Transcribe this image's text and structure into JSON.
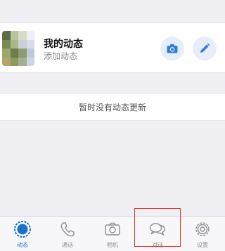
{
  "status": {
    "title": "我的动态",
    "subtitle": "添加动态",
    "camera_icon": "camera-icon",
    "pencil_icon": "pencil-icon"
  },
  "updates": {
    "empty_text": "暂时没有动态更新"
  },
  "tabbar": {
    "active": "动态",
    "tabs": [
      {
        "label": "动态",
        "icon": "status-ring-icon"
      },
      {
        "label": "通话",
        "icon": "phone-icon"
      },
      {
        "label": "相机",
        "icon": "camera-icon"
      },
      {
        "label": "对话",
        "icon": "chat-bubbles-icon"
      },
      {
        "label": "设置",
        "icon": "gear-icon"
      }
    ]
  },
  "colors": {
    "accent": "#1a73c8",
    "background": "#efeff4",
    "highlight": "#e0342c"
  }
}
